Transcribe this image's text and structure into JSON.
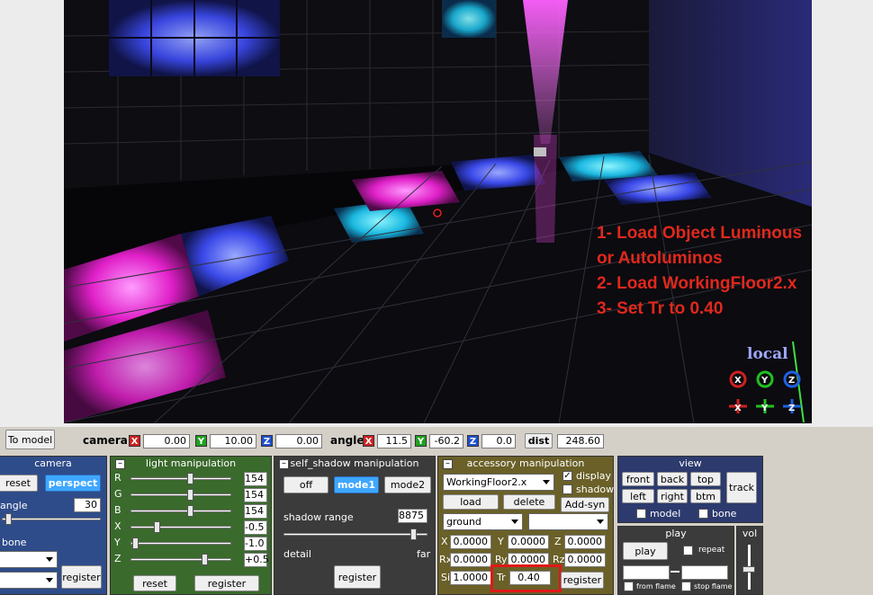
{
  "viewport": {
    "instructions": [
      "1- Load Object Luminous",
      "or Autoluminos",
      "2- Load WorkingFloor2.x",
      "3- Set Tr to 0.40"
    ],
    "mode_label": "local",
    "gizmo_top": [
      "X",
      "Y",
      "Z"
    ],
    "gizmo_bottom": [
      "X",
      "Y",
      "Z"
    ]
  },
  "camera_row": {
    "to_model": "To model",
    "camera_label": "camera",
    "camera_x": "0.00",
    "camera_y": "10.00",
    "camera_z": "0.00",
    "angle_label": "angle",
    "angle_x": "11.5",
    "angle_y": "-60.2",
    "angle_z": "0.0",
    "dist_label": "dist",
    "dist_value": "248.60",
    "axis_x": "X",
    "axis_y": "Y",
    "axis_z": "Z"
  },
  "camera_panel": {
    "title": "camera",
    "reset": "reset",
    "perspect": "perspect",
    "angle_label": "angle",
    "angle_value": "30",
    "bone_label": "bone",
    "register": "register"
  },
  "light_panel": {
    "title": "light manipulation",
    "rows": [
      {
        "label": "R",
        "value": "154",
        "level": 0.6
      },
      {
        "label": "G",
        "value": "154",
        "level": 0.6
      },
      {
        "label": "B",
        "value": "154",
        "level": 0.6
      },
      {
        "label": "X",
        "value": "-0.5",
        "level": 0.25
      },
      {
        "label": "Y",
        "value": "-1.0",
        "level": 0.02
      },
      {
        "label": "Z",
        "value": "+0.5",
        "level": 0.75
      }
    ],
    "reset": "reset",
    "register": "register"
  },
  "shadow_panel": {
    "title": "self_shadow manipulation",
    "off": "off",
    "mode1": "mode1",
    "mode2": "mode2",
    "range_label": "shadow range",
    "range_value": "8875",
    "range_level": 0.92,
    "detail": "detail",
    "far": "far",
    "register": "register"
  },
  "accessory_panel": {
    "title": "accessory manipulation",
    "accessory": "WorkingFloor2.x",
    "display": "display",
    "shadow": "shadow",
    "load": "load",
    "delete": "delete",
    "add_syn": "Add-syn",
    "parent": "ground",
    "parent_bone": "",
    "x_label": "X",
    "x": "0.0000",
    "y_label": "Y",
    "y": "0.0000",
    "z_label": "Z",
    "z": "0.0000",
    "rx_label": "Rx",
    "rx": "0.0000",
    "ry_label": "Ry",
    "ry": "0.0000",
    "rz_label": "Rz",
    "rz": "0.0000",
    "si_label": "Si",
    "si": "1.0000",
    "tr_label": "Tr",
    "tr": "0.40",
    "register": "register"
  },
  "view_panel": {
    "title": "view",
    "front": "front",
    "back": "back",
    "top": "top",
    "left": "left",
    "right": "right",
    "btm": "btm",
    "track": "track",
    "model": "model",
    "bone": "bone"
  },
  "play_panel": {
    "title": "play",
    "play": "play",
    "repeat": "repeat",
    "from_flame": "from flame",
    "stop_flame": "stop flame"
  },
  "vol_panel": {
    "title": "vol"
  },
  "colors": {
    "light_panel_bg": "#3a6a2c",
    "shadow_panel_bg": "#3b3b3b",
    "accessory_panel_bg": "#6a6028",
    "view_panel_bg": "#2c3a6e",
    "highlight_red": "#e01818"
  }
}
